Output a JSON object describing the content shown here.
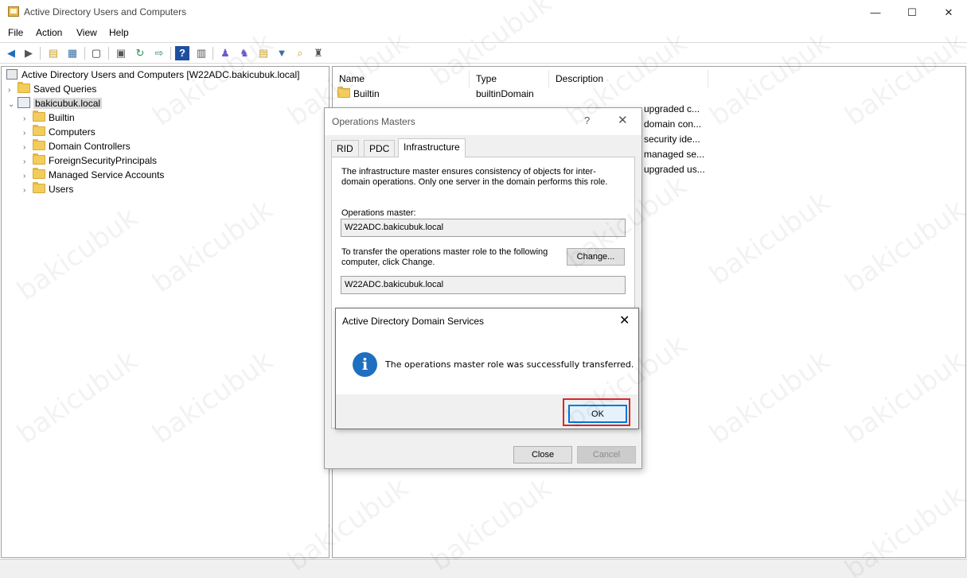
{
  "window": {
    "title": "Active Directory Users and Computers",
    "minimize": "—",
    "maximize": "☐",
    "close": "✕"
  },
  "menu": [
    "File",
    "Action",
    "View",
    "Help"
  ],
  "tree": {
    "root": "Active Directory Users and Computers [W22ADC.bakicubuk.local]",
    "saved_queries": "Saved Queries",
    "domain": "bakicubuk.local",
    "children": [
      "Builtin",
      "Computers",
      "Domain Controllers",
      "ForeignSecurityPrincipals",
      "Managed Service Accounts",
      "Users"
    ]
  },
  "list": {
    "columns": [
      "Name",
      "Type",
      "Description"
    ],
    "rows": [
      {
        "name": "Builtin",
        "type": "builtinDomain",
        "description": ""
      }
    ],
    "visible_description_fragments": [
      "upgraded c...",
      "domain con...",
      "security ide...",
      "managed se...",
      "upgraded us..."
    ]
  },
  "ops_dialog": {
    "title": "Operations Masters",
    "help": "?",
    "close": "✕",
    "tabs": [
      "RID",
      "PDC",
      "Infrastructure"
    ],
    "active_tab": "Infrastructure",
    "description": "The infrastructure master ensures consistency of objects for inter-domain operations. Only one server in the domain performs this role.",
    "ops_master_label": "Operations master:",
    "ops_master_value": "W22ADC.bakicubuk.local",
    "transfer_text": "To transfer the operations master role to the following computer, click Change.",
    "change_button": "Change...",
    "target_value": "W22ADC.bakicubuk.local",
    "close_button": "Close",
    "cancel_button": "Cancel"
  },
  "message_box": {
    "title": "Active Directory Domain Services",
    "close": "✕",
    "message": "The operations master role was successfully transferred.",
    "ok_button": "OK"
  },
  "watermark": "bakicubuk",
  "colors": {
    "info_icon": "#1f6fc0",
    "highlight": "#d7282f",
    "ok_focus": "#0078d7"
  }
}
